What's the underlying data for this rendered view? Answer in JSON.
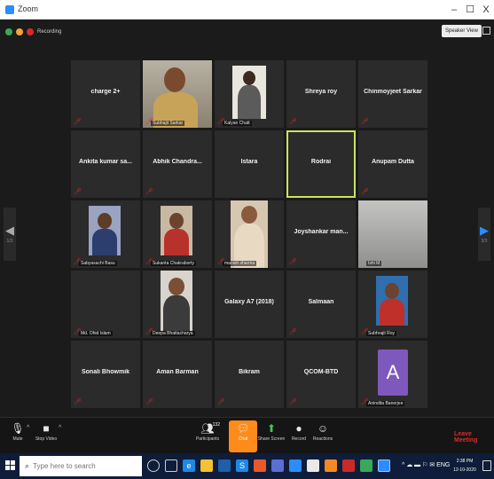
{
  "window": {
    "title": "Zoom",
    "minimize": "–",
    "maximize": "☐",
    "close": "X"
  },
  "topbar": {
    "recording_label": "Recording",
    "view_label": "Speaker View"
  },
  "nav": {
    "left_page": "1/3",
    "right_page": "3/3"
  },
  "participants": [
    {
      "name": "charge 2+",
      "video": false,
      "muted": true
    },
    {
      "name": "Subhajit Sarkar",
      "video": true,
      "muted": true
    },
    {
      "name": "Kalyan Chatt",
      "video": true,
      "muted": true
    },
    {
      "name": "Shreya roy",
      "video": false,
      "muted": true
    },
    {
      "name": "Chinmoyjeet Sarkar",
      "video": false,
      "muted": true
    },
    {
      "name": "Ankita kumar sa...",
      "video": false,
      "muted": true
    },
    {
      "name": "Abhik Chandra...",
      "video": false,
      "muted": true
    },
    {
      "name": "Istara",
      "video": false,
      "muted": false
    },
    {
      "name": "Rodrai",
      "video": false,
      "muted": false,
      "active_speaker": true
    },
    {
      "name": "Anupam Dutta",
      "video": false,
      "muted": true
    },
    {
      "name": "Sabyasachi Basu",
      "video": true,
      "muted": true
    },
    {
      "name": "Sukanta Chakraborty",
      "video": true,
      "muted": true
    },
    {
      "name": "manish sharma",
      "video": true,
      "muted": true
    },
    {
      "name": "Joyshankar man...",
      "video": false,
      "muted": true
    },
    {
      "name": "Ishi M",
      "video": true,
      "muted": false
    },
    {
      "name": "Md. Ohid Islam",
      "video": false,
      "muted": true
    },
    {
      "name": "Deepa Bhattacharya",
      "video": true,
      "muted": true
    },
    {
      "name": "Galaxy A7 (2018)",
      "video": false,
      "muted": false
    },
    {
      "name": "Salmaan",
      "video": false,
      "muted": true
    },
    {
      "name": "Subhrajit Roy",
      "video": true,
      "muted": true
    },
    {
      "name": "Sonali Bhowmik",
      "video": false,
      "muted": true
    },
    {
      "name": "Aman Barman",
      "video": false,
      "muted": true
    },
    {
      "name": "Bikram",
      "video": false,
      "muted": true
    },
    {
      "name": "QCOM-BTD",
      "video": false,
      "muted": true
    },
    {
      "name": "Anindita Banerjee",
      "video": false,
      "muted": true,
      "avatar_letter": "A"
    }
  ],
  "toolbar": {
    "mute": "Mute",
    "stop_video": "Stop Video",
    "participants": "Participants",
    "participants_count": "132",
    "chat": "Chat",
    "share_screen": "Share Screen",
    "record": "Record",
    "reactions": "Reactions",
    "leave": "Leave Meeting"
  },
  "taskbar": {
    "search_placeholder": "Type here to search",
    "time": "2:38 PM",
    "date": "12-10-2020",
    "language": "ENG"
  },
  "colors": {
    "active_speaker_border": "#c9e65a",
    "chat_accent": "#ff8c1a",
    "mute_red": "#e02828",
    "avatar_purple": "#7e58bd"
  }
}
